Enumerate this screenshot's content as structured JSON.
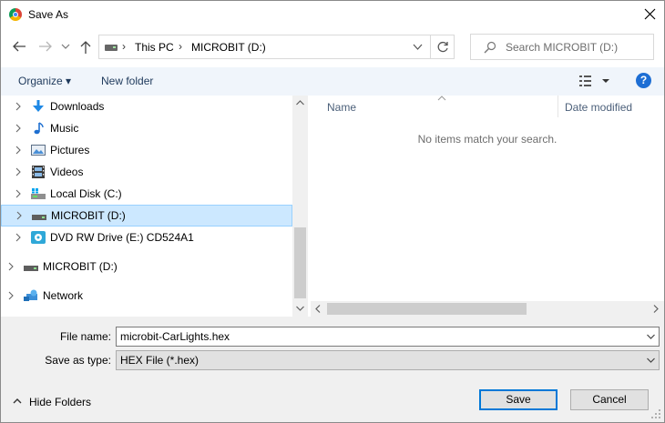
{
  "window": {
    "title": "Save As",
    "icon": "chrome-icon"
  },
  "address": {
    "crumbs": [
      "This PC",
      "MICROBIT (D:)"
    ],
    "separator": "›",
    "search_placeholder": "Search MICROBIT (D:)"
  },
  "toolbar": {
    "organize": "Organize ▾",
    "new_folder": "New folder",
    "help": "?"
  },
  "tree": [
    {
      "label": "Downloads",
      "icon": "downloads-icon"
    },
    {
      "label": "Music",
      "icon": "music-icon"
    },
    {
      "label": "Pictures",
      "icon": "pictures-icon"
    },
    {
      "label": "Videos",
      "icon": "videos-icon"
    },
    {
      "label": "Local Disk (C:)",
      "icon": "local-disk-icon"
    },
    {
      "label": "MICROBIT (D:)",
      "icon": "drive-icon",
      "selected": true
    },
    {
      "label": "DVD RW Drive (E:) CD524A1",
      "icon": "dvd-drive-icon"
    },
    {
      "label": "MICROBIT (D:)",
      "icon": "drive-icon"
    },
    {
      "label": "Network",
      "icon": "network-icon"
    }
  ],
  "list": {
    "columns": [
      "Name",
      "Date modified"
    ],
    "empty_message": "No items match your search."
  },
  "form": {
    "file_name_label": "File name:",
    "file_name_value": "microbit-CarLights.hex",
    "save_type_label": "Save as type:",
    "save_type_value": "HEX File (*.hex)"
  },
  "footer": {
    "hide_folders": "Hide Folders",
    "save": "Save",
    "cancel": "Cancel"
  },
  "colors": {
    "selection": "#cce8ff",
    "accent": "#0078d7",
    "toolbar_bg": "#f0f5fb",
    "link_text": "#1e395b"
  }
}
